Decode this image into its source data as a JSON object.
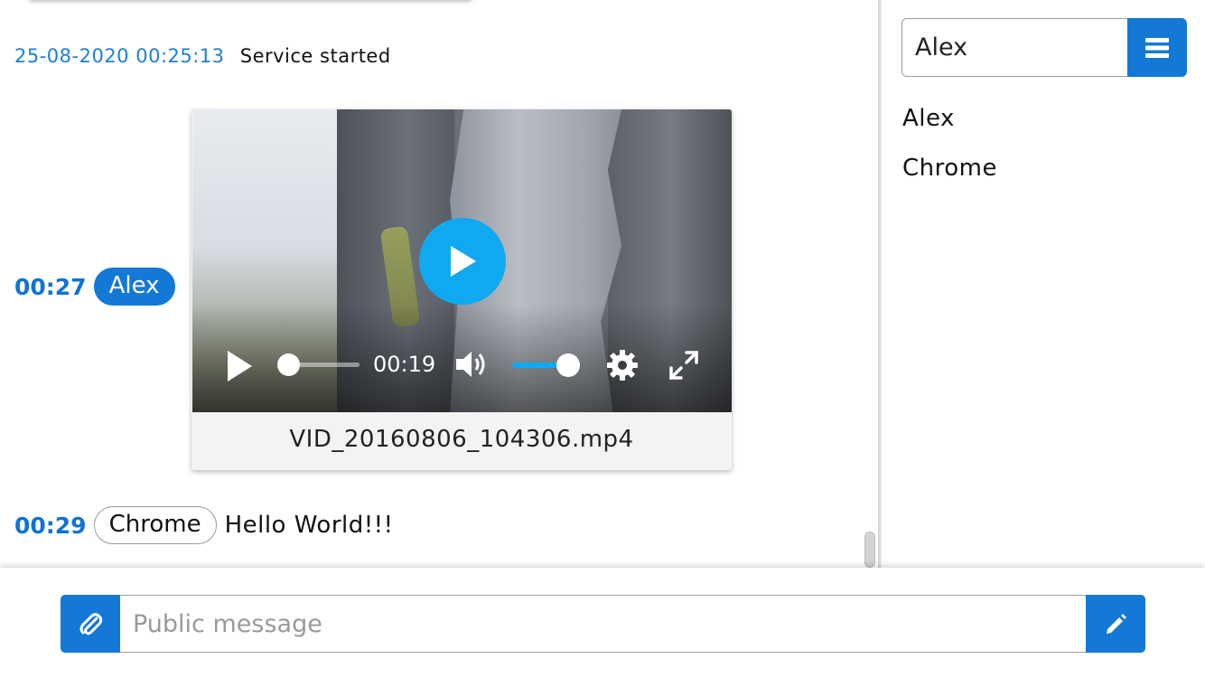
{
  "chat": {
    "system_message": {
      "timestamp": "25-08-2020 00:25:13",
      "text": "Service started"
    },
    "messages": [
      {
        "time": "00:27",
        "user": "Alex",
        "attachment": {
          "file_name": "VID_20160806_104306.mp4",
          "player": {
            "time_display": "00:19",
            "progress_fraction": 0.0,
            "volume_fraction": 1.0
          }
        }
      },
      {
        "time": "00:29",
        "user": "Chrome",
        "text": "Hello World!!!"
      }
    ]
  },
  "sidebar": {
    "filter_value": "Alex",
    "users": [
      "Alex",
      "Chrome"
    ]
  },
  "composer": {
    "placeholder": "Public message"
  },
  "icons": {
    "menu": "bars-icon",
    "attach": "paperclip-icon",
    "send": "pencil-icon",
    "big_play": "play-icon",
    "play": "play-icon",
    "volume": "volume-icon",
    "settings": "gear-icon",
    "fullscreen": "fullscreen-icon"
  },
  "colors": {
    "accent": "#1479d6",
    "timestamp": "#1e7fd6",
    "player_accent": "#10a9f0"
  }
}
